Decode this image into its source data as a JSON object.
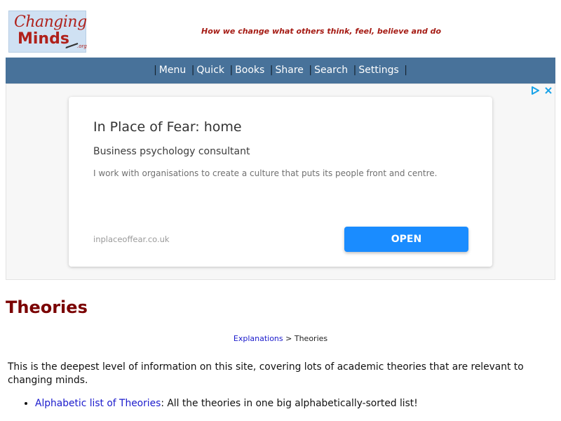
{
  "header": {
    "logo_line1": "Changing",
    "logo_line2": "Minds",
    "logo_suffix": ".org",
    "tagline": "How we change what others think, feel, believe and do"
  },
  "nav": {
    "items": [
      "Menu",
      "Quick",
      "Books",
      "Share",
      "Search",
      "Settings"
    ],
    "separator": "|"
  },
  "ad": {
    "adchoices_icon": "adchoices-icon",
    "close_icon": "close-icon",
    "title": "In Place of Fear: home",
    "subtitle": "Business psychology consultant",
    "description": "I work with organisations to create a culture that puts its people front and centre.",
    "domain": "inplaceoffear.co.uk",
    "button_label": "OPEN",
    "button_color": "#1a8cff"
  },
  "content": {
    "title": "Theories",
    "breadcrumb": {
      "parent": "Explanations",
      "separator": ">",
      "current": "Theories"
    },
    "intro": "This is the deepest level of information on this site, covering lots of academic theories that are relevant to changing minds.",
    "list": [
      {
        "link": "Alphabetic list of Theories",
        "text": ": All the theories in one big alphabetically-sorted list!"
      }
    ]
  },
  "colors": {
    "brand_red": "#b0211b",
    "nav_blue": "#48729a",
    "title_maroon": "#7a0000",
    "link_blue": "#1a1acc"
  }
}
